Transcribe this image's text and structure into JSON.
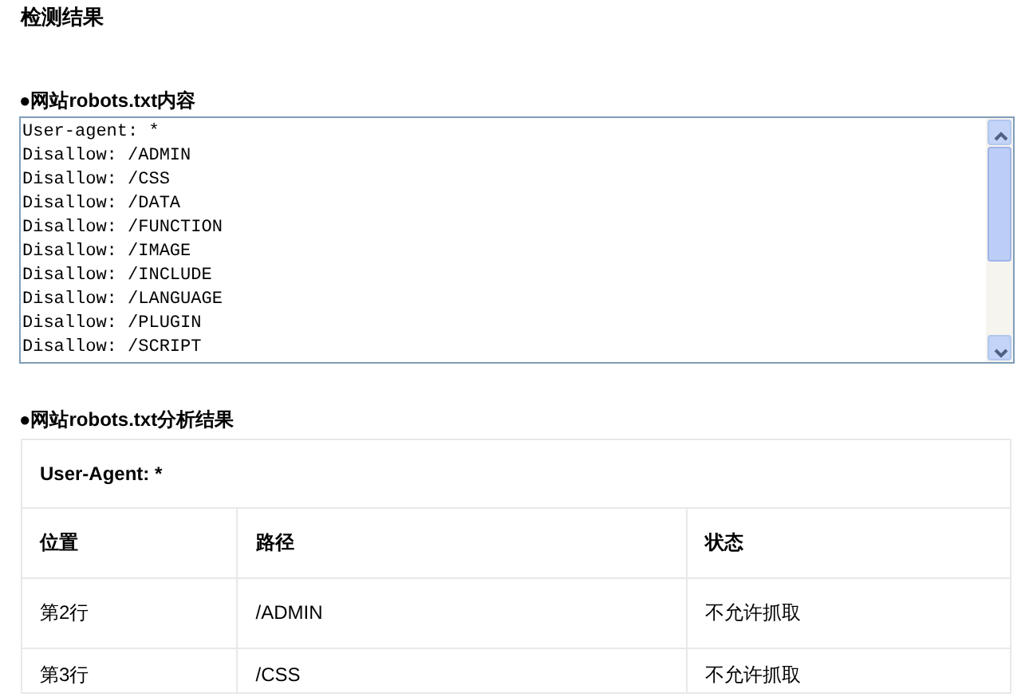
{
  "title": "检测结果",
  "robots_section": {
    "heading": "●网站robots.txt内容",
    "lines": [
      "User-agent: *",
      "Disallow: /ADMIN",
      "Disallow: /CSS",
      "Disallow: /DATA",
      "Disallow: /FUNCTION",
      "Disallow: /IMAGE",
      "Disallow: /INCLUDE",
      "Disallow: /LANGUAGE",
      "Disallow: /PLUGIN",
      "Disallow: /SCRIPT"
    ]
  },
  "analysis_section": {
    "heading": "●网站robots.txt分析结果",
    "table": {
      "caption": "User-Agent: *",
      "columns": [
        "位置",
        "路径",
        "状态"
      ],
      "rows": [
        [
          "第2行",
          "/ADMIN",
          "不允许抓取"
        ],
        [
          "第3行",
          "/CSS",
          "不允许抓取"
        ]
      ]
    }
  }
}
